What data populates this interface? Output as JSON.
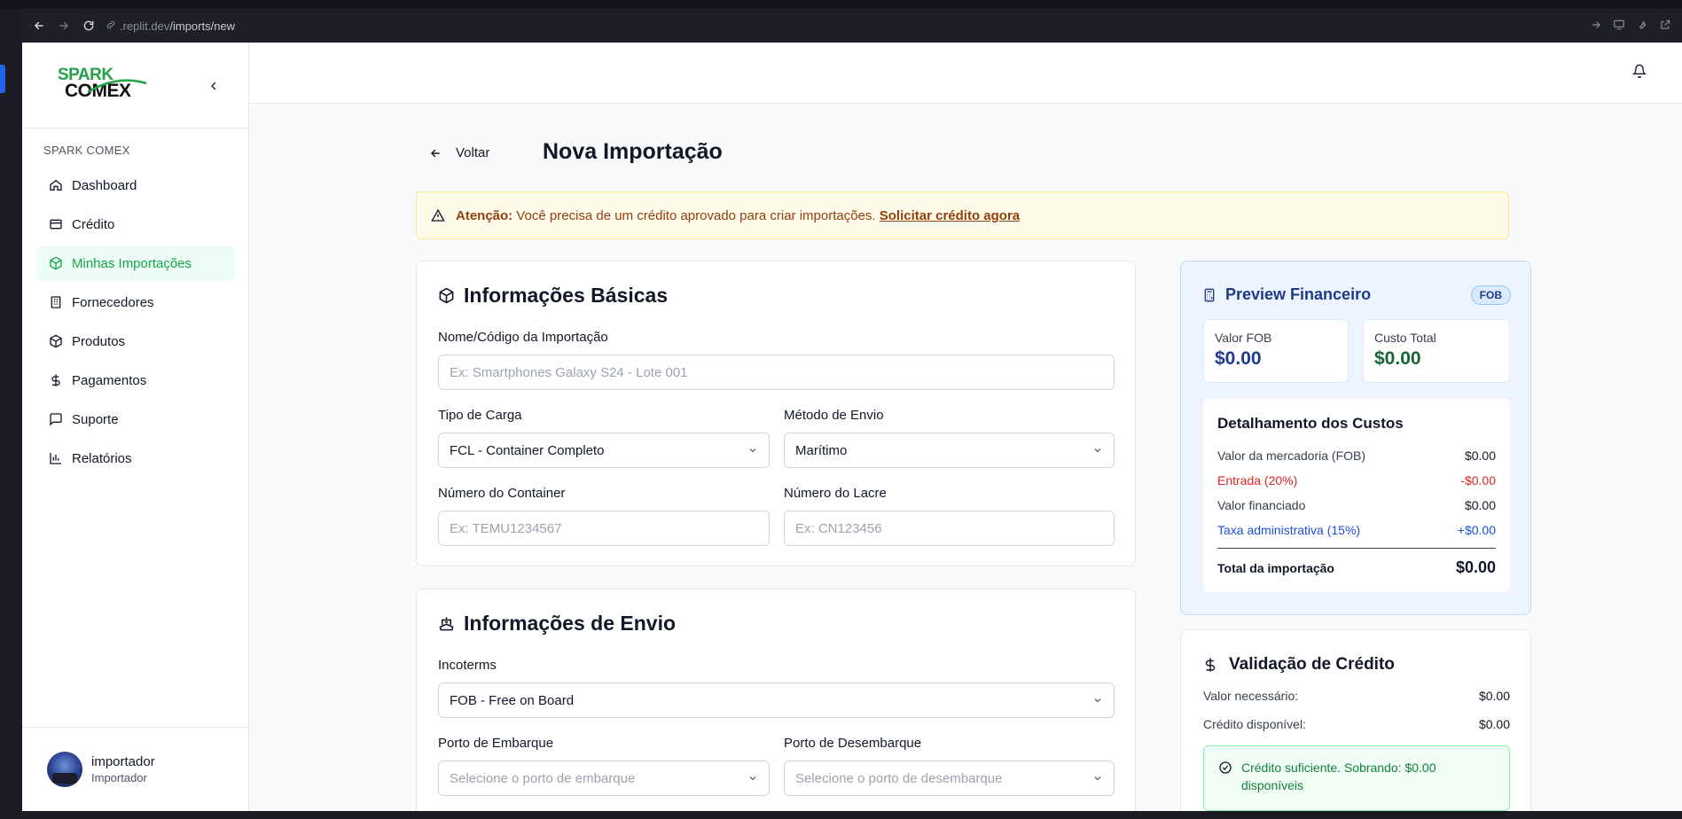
{
  "browser": {
    "url_prefix": ".replit.dev",
    "url_path": "/imports/new"
  },
  "sidebar": {
    "logo_top": "SPARK",
    "logo_bottom": "COMEX",
    "section_label": "SPARK COMEX",
    "items": [
      {
        "label": "Dashboard",
        "icon": "home-icon"
      },
      {
        "label": "Crédito",
        "icon": "credit-card-icon"
      },
      {
        "label": "Minhas Importações",
        "icon": "package-icon"
      },
      {
        "label": "Fornecedores",
        "icon": "building-icon"
      },
      {
        "label": "Produtos",
        "icon": "box-icon"
      },
      {
        "label": "Pagamentos",
        "icon": "dollar-icon"
      },
      {
        "label": "Suporte",
        "icon": "message-icon"
      },
      {
        "label": "Relatórios",
        "icon": "bar-chart-icon"
      }
    ],
    "user": {
      "name": "importador",
      "role": "Importador"
    }
  },
  "header": {
    "back_label": "Voltar",
    "title": "Nova Importação"
  },
  "alert": {
    "strong": "Atenção:",
    "text": "Você precisa de um crédito aprovado para criar importações.",
    "link": "Solicitar crédito agora"
  },
  "basic": {
    "title": "Informações Básicas",
    "name_label": "Nome/Código da Importação",
    "name_placeholder": "Ex: Smartphones Galaxy S24 - Lote 001",
    "cargo_label": "Tipo de Carga",
    "cargo_value": "FCL - Container Completo",
    "method_label": "Método de Envio",
    "method_value": "Marítimo",
    "container_label": "Número do Container",
    "container_placeholder": "Ex: TEMU1234567",
    "seal_label": "Número do Lacre",
    "seal_placeholder": "Ex: CN123456"
  },
  "shipping": {
    "title": "Informações de Envio",
    "incoterms_label": "Incoterms",
    "incoterms_value": "FOB - Free on Board",
    "origin_label": "Porto de Embarque",
    "origin_placeholder": "Selecione o porto de embarque",
    "dest_label": "Porto de Desembarque",
    "dest_placeholder": "Selecione o porto de desembarque"
  },
  "preview": {
    "title": "Preview Financeiro",
    "badge": "FOB",
    "fob_label": "Valor FOB",
    "fob_value": "$0.00",
    "total_label": "Custo Total",
    "total_value": "$0.00",
    "details_title": "Detalhamento dos Custos",
    "rows": [
      {
        "label": "Valor da mercadoria (FOB)",
        "value": "$0.00"
      },
      {
        "label": "Entrada (20%)",
        "value": "-$0.00"
      },
      {
        "label": "Valor financiado",
        "value": "$0.00"
      },
      {
        "label": "Taxa administrativa (15%)",
        "value": "+$0.00"
      }
    ],
    "grand_label": "Total da importação",
    "grand_value": "$0.00",
    "colors": {
      "fob": "#1e3a8a",
      "total": "#166534"
    }
  },
  "credit": {
    "title": "Validação de Crédito",
    "needed_label": "Valor necessário:",
    "needed_value": "$0.00",
    "available_label": "Crédito disponível:",
    "available_value": "$0.00",
    "success": "Crédito suficiente. Sobrando: $0.00 disponíveis"
  }
}
